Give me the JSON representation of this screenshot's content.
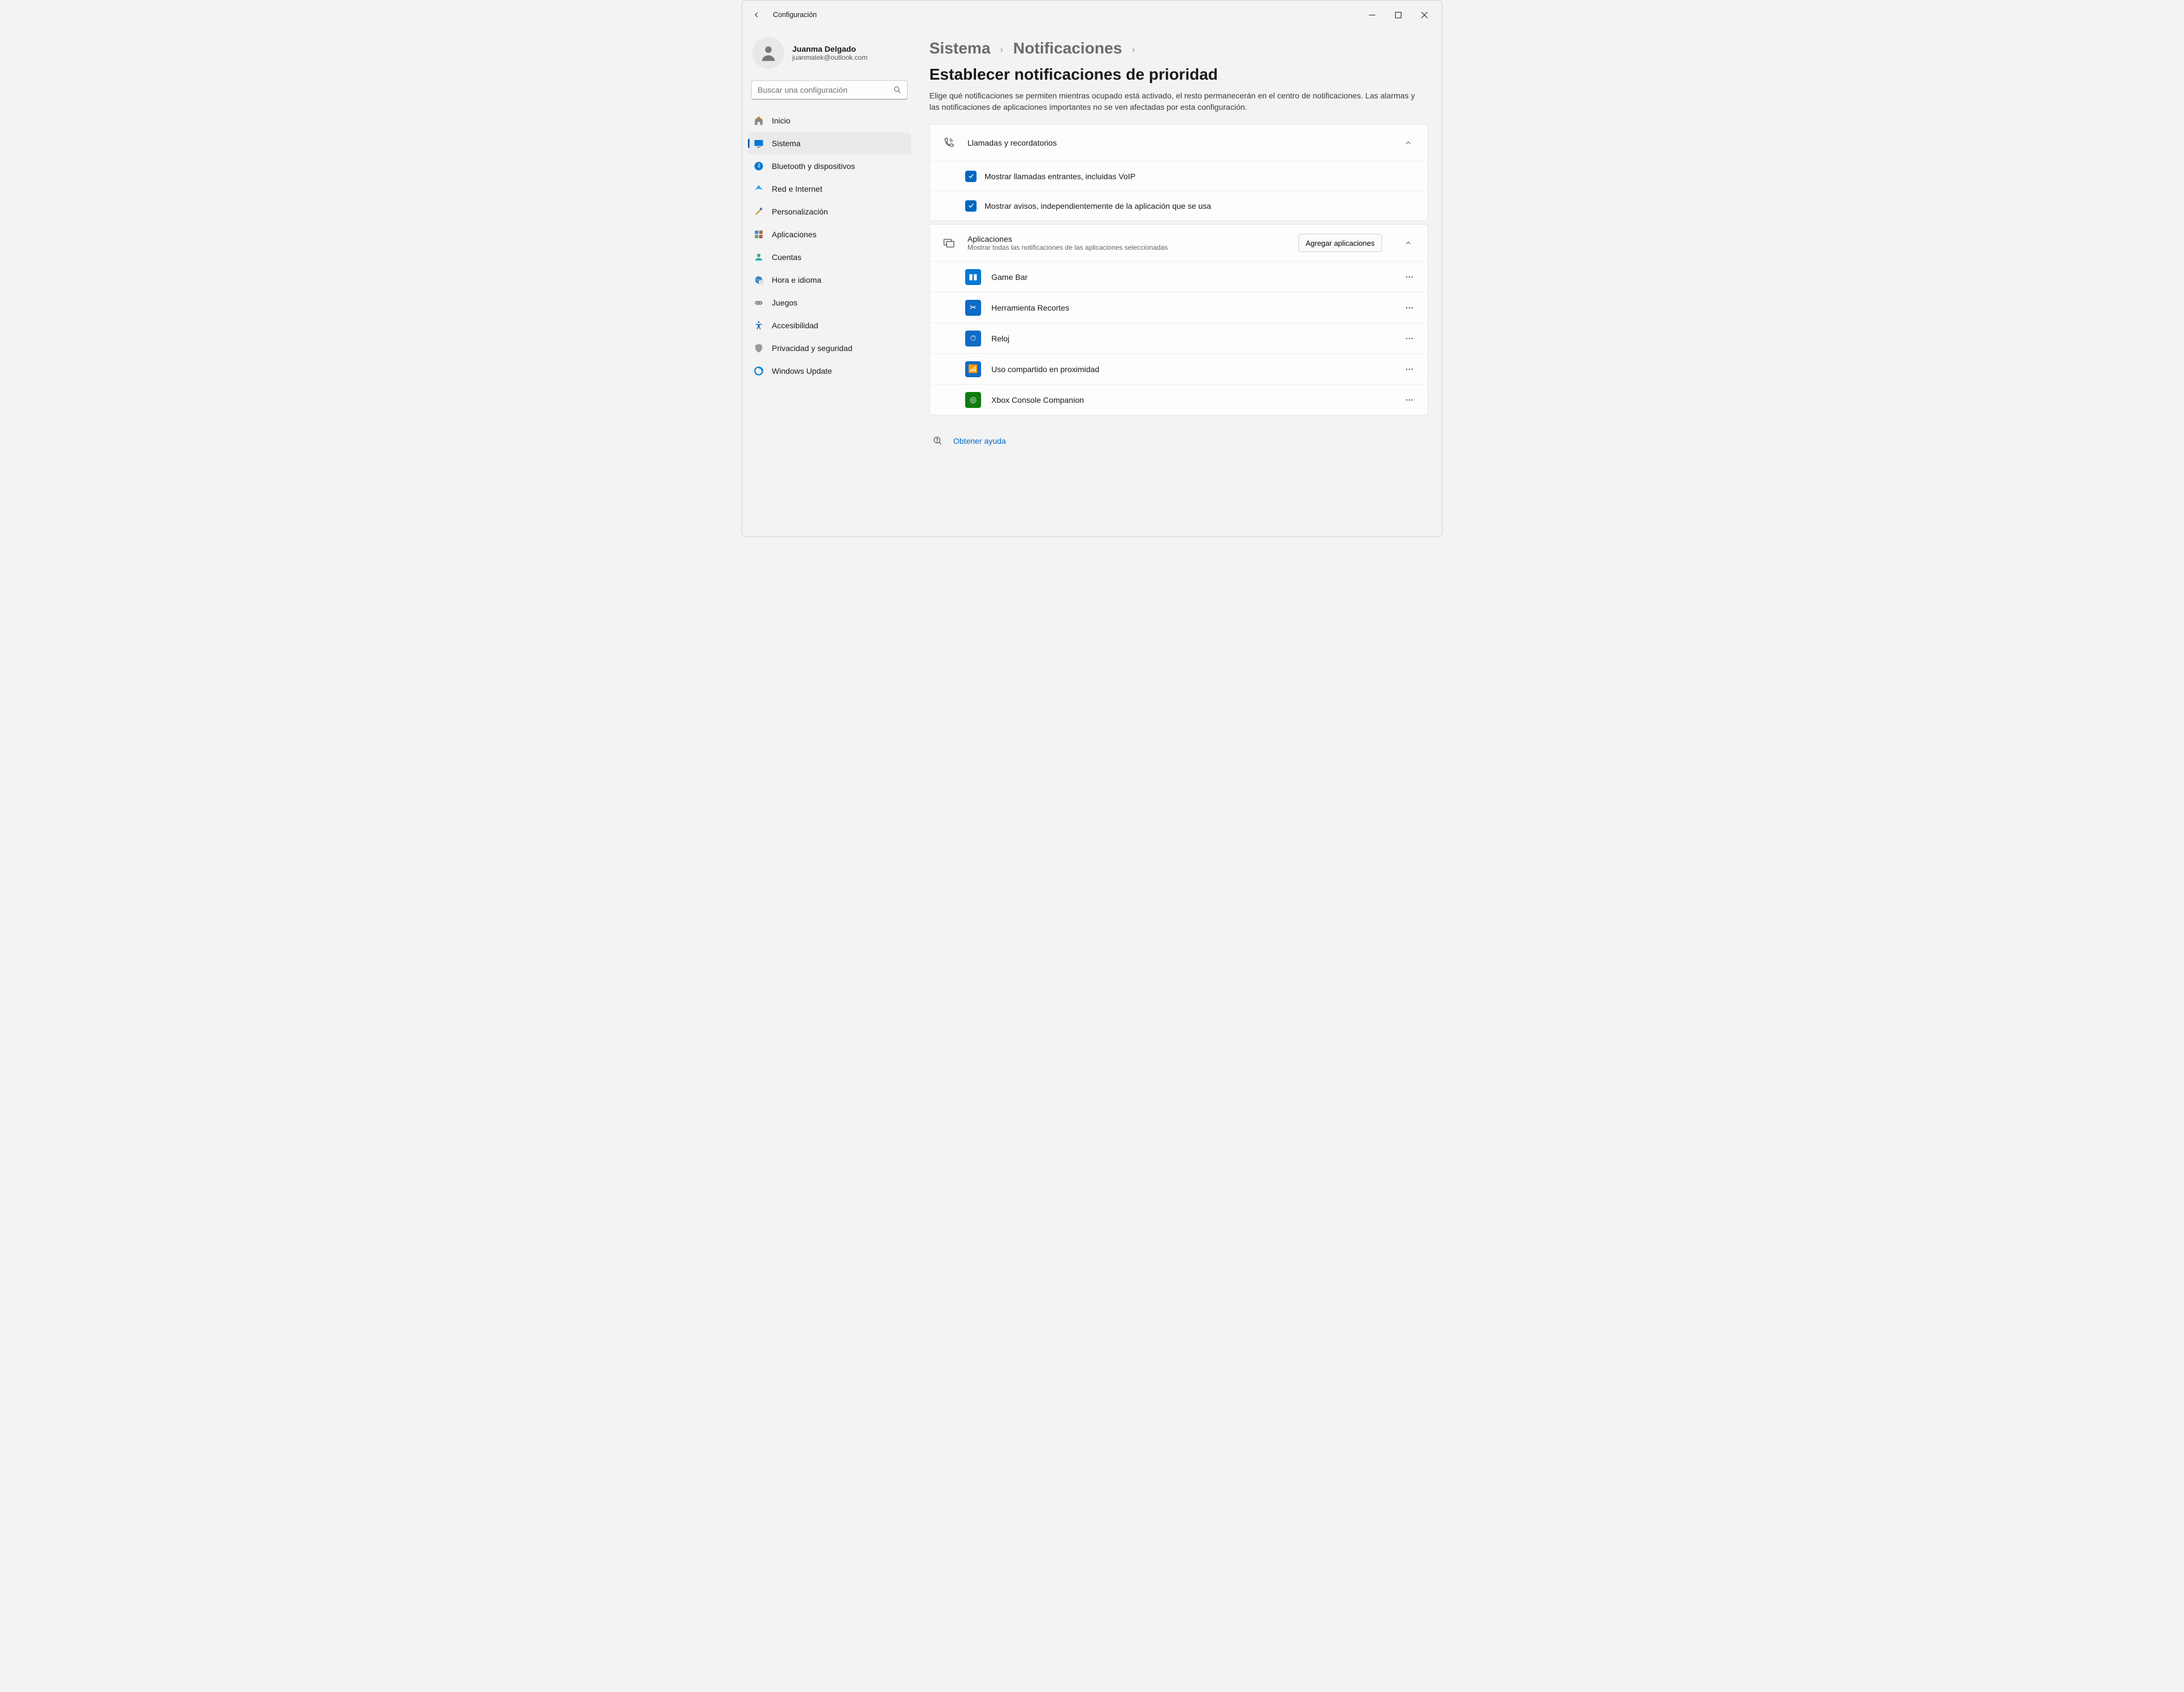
{
  "window": {
    "title": "Configuración"
  },
  "profile": {
    "name": "Juanma Delgado",
    "email": "juanmatek@outlook.com"
  },
  "search": {
    "placeholder": "Buscar una configuración"
  },
  "nav": {
    "home": "Inicio",
    "system": "Sistema",
    "bluetooth": "Bluetooth y dispositivos",
    "network": "Red e Internet",
    "personalization": "Personalización",
    "apps": "Aplicaciones",
    "accounts": "Cuentas",
    "time_lang": "Hora e idioma",
    "gaming": "Juegos",
    "accessibility": "Accesibilidad",
    "privacy": "Privacidad y seguridad",
    "update": "Windows Update"
  },
  "breadcrumb": {
    "l1": "Sistema",
    "l2": "Notificaciones",
    "l3": "Establecer notificaciones de prioridad"
  },
  "subtitle": "Elige qué notificaciones se permiten mientras ocupado está activado, el resto permanecerán en el centro de notificaciones. Las alarmas y las notificaciones de aplicaciones importantes no se ven afectadas por esta configuración.",
  "section_calls": {
    "title": "Llamadas y recordatorios",
    "opt_incoming": "Mostrar llamadas entrantes, incluidas VoIP",
    "opt_reminders": "Mostrar avisos, independientemente de la aplicación que se usa"
  },
  "section_apps": {
    "title": "Aplicaciones",
    "subtitle": "Mostrar todas las notificaciones de las aplicaciones seleccionadas",
    "add_button": "Agregar aplicaciones",
    "items": [
      {
        "name": "Game Bar",
        "icon_bg": "#0078d4",
        "glyph": "▮▮"
      },
      {
        "name": "Herramienta Recortes",
        "icon_bg": "#0f6bc5",
        "glyph": "✂"
      },
      {
        "name": "Reloj",
        "icon_bg": "#0f6bc5",
        "glyph": "⏱"
      },
      {
        "name": "Uso compartido en proximidad",
        "icon_bg": "#0f6bc5",
        "glyph": "📶"
      },
      {
        "name": "Xbox Console Companion",
        "icon_bg": "#107c10",
        "glyph": "◎"
      }
    ]
  },
  "footer": {
    "help": "Obtener ayuda"
  }
}
